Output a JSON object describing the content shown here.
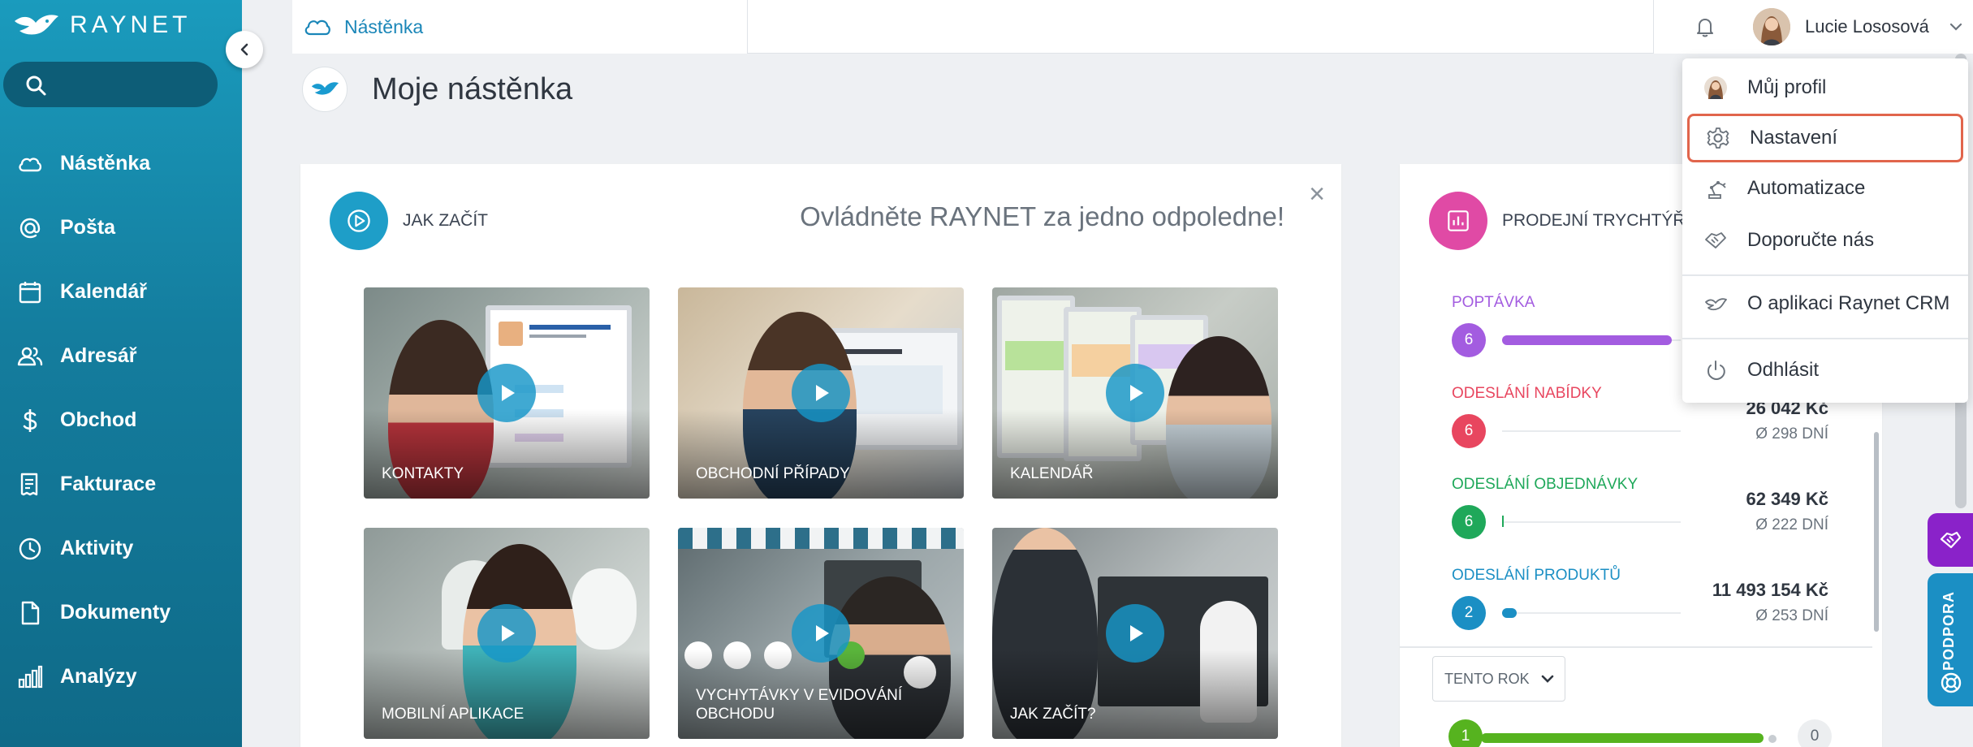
{
  "app": {
    "logo_text": "RAYNET"
  },
  "sidebar": {
    "items": [
      {
        "label": "Nástěnka",
        "icon": "cloud-icon"
      },
      {
        "label": "Pošta",
        "icon": "at-icon"
      },
      {
        "label": "Kalendář",
        "icon": "calendar-icon"
      },
      {
        "label": "Adresář",
        "icon": "contacts-icon"
      },
      {
        "label": "Obchod",
        "icon": "dollar-icon"
      },
      {
        "label": "Fakturace",
        "icon": "invoice-icon"
      },
      {
        "label": "Aktivity",
        "icon": "clock-icon"
      },
      {
        "label": "Dokumenty",
        "icon": "document-icon"
      },
      {
        "label": "Analýzy",
        "icon": "bar-chart-icon"
      }
    ]
  },
  "topbar": {
    "tab_label": "Nástěnka",
    "user_name": "Lucie Lososová"
  },
  "page": {
    "title": "Moje nástěnka"
  },
  "jak_zacit": {
    "title": "JAK ZAČÍT",
    "subtitle": "Ovládněte RAYNET za jedno odpoledne!",
    "close": "×",
    "videos": [
      {
        "label": "KONTAKTY"
      },
      {
        "label": "OBCHODNÍ PŘÍPADY"
      },
      {
        "label": "KALENDÁŘ"
      },
      {
        "label": "MOBILNÍ APLIKACE"
      },
      {
        "label": "VYCHYTÁVKY V EVIDOVÁNÍ OBCHODU"
      },
      {
        "label": "JAK ZAČÍT?"
      }
    ]
  },
  "funnel": {
    "title": "PRODEJNÍ TRYCHTÝŘ",
    "stages": [
      {
        "name": "POPTÁVKA",
        "count": "6",
        "color": "#a35ce0",
        "fill": 0.95,
        "amount": "",
        "days": ""
      },
      {
        "name": "ODESLÁNÍ NABÍDKY",
        "count": "6",
        "color": "#e8465f",
        "fill": 0,
        "amount": "26 042 Kč",
        "days": "Ø 298 DNÍ"
      },
      {
        "name": "ODESLÁNÍ OBJEDNÁVKY",
        "count": "6",
        "color": "#1fa85a",
        "fill": 0.01,
        "amount": "62 349 Kč",
        "days": "Ø 222 DNÍ"
      },
      {
        "name": "ODESLÁNÍ PRODUKTŮ",
        "count": "2",
        "color": "#1b8fc4",
        "fill": 0.08,
        "amount": "11 493 154 Kč",
        "days": "Ø 253 DNÍ"
      }
    ],
    "period": "TENTO ROK",
    "bottom": {
      "left_count": "1",
      "right_count": "0",
      "color": "#56b31f"
    }
  },
  "dropdown": {
    "items": [
      {
        "label": "Můj profil",
        "icon": "avatar-icon"
      },
      {
        "label": "Nastavení",
        "icon": "gear-icon"
      },
      {
        "label": "Automatizace",
        "icon": "robot-arm-icon"
      },
      {
        "label": "Doporučte nás",
        "icon": "handshake-icon"
      },
      {
        "label": "O aplikaci Raynet CRM",
        "icon": "raynet-bird-icon"
      },
      {
        "label": "Odhlásit",
        "icon": "power-icon"
      }
    ]
  },
  "support": {
    "label": "PODPORA"
  },
  "colors": {
    "sidebar": "#1a9bbd",
    "accent": "#1e9ec8",
    "highlight": "#e1654c"
  }
}
